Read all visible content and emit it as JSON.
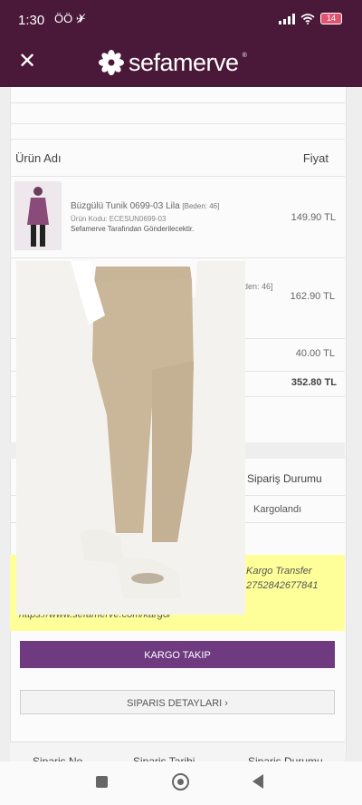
{
  "status_bar": {
    "time": "1:30",
    "icons_left": "ÖÖ ✈̸",
    "battery": "14",
    "colors": {
      "bar": "#4a1838",
      "battery": "#e05470"
    }
  },
  "app": {
    "close_icon": "close-icon",
    "brand": "sefamerve",
    "brand_mark": "®"
  },
  "order_table": {
    "col_product": "Ürün Adı",
    "col_price": "Fiyat",
    "products": [
      {
        "title": "Büzgülü Tunik 0699-03 Lila",
        "size": "[Beden: 46]",
        "code": "Ürün Kodu: ECESUN0699-03",
        "shipping": "Sefamerve Tarafından Gönderilecektir.",
        "price": "149.90 TL"
      },
      {
        "size_partial": "den: 46]",
        "price": "162.90 TL"
      }
    ],
    "shipping_fee": "40.00 TL",
    "total": "352.80 TL"
  },
  "order_status": {
    "header": "Sipariş Durumu",
    "value": "Kargolandı"
  },
  "cargo": {
    "carrier": "Kargo Transfer",
    "tracking": "2752842677841",
    "url": "https://www.sefamerve.com/kargo/"
  },
  "buttons": {
    "track": "KARGO TAKIP",
    "details": "SIPARIS DETAYLARI ›"
  },
  "next_order": {
    "col1": "Siparis No",
    "col2": "Siparis Tarihi",
    "col3": "Siparis Durumu"
  },
  "colors": {
    "accent": "#6f3a80",
    "highlight": "#ffff99"
  }
}
